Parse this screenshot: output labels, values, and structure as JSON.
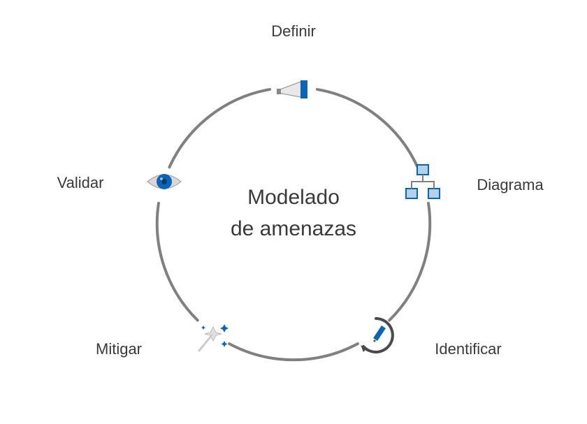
{
  "title_line1": "Modelado",
  "title_line2": "de amenazas",
  "nodes": {
    "definir": {
      "label": "Definir"
    },
    "diagrama": {
      "label": "Diagrama"
    },
    "identificar": {
      "label": "Identificar"
    },
    "mitigar": {
      "label": "Mitigar"
    },
    "validar": {
      "label": "Validar"
    }
  },
  "colors": {
    "ring": "#808080",
    "accent": "#0a64b8",
    "accentLight": "#b3d2ea",
    "text": "#3a3a3a"
  }
}
